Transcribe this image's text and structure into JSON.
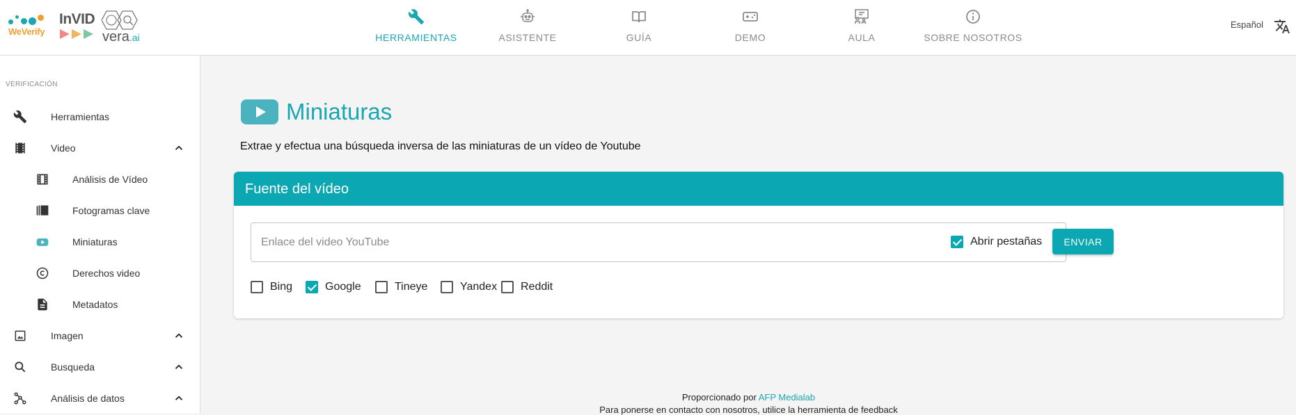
{
  "header": {
    "logos": {
      "weverify": "WeVerify",
      "invid": "InVID",
      "vera": "vera",
      "vera_suffix": ".ai"
    },
    "nav": [
      {
        "label": "HERRAMIENTAS",
        "icon": "wrench-icon",
        "active": true
      },
      {
        "label": "ASISTENTE",
        "icon": "robot-icon",
        "active": false
      },
      {
        "label": "GUÍA",
        "icon": "book-icon",
        "active": false
      },
      {
        "label": "DEMO",
        "icon": "gamepad-icon",
        "active": false
      },
      {
        "label": "AULA",
        "icon": "classroom-icon",
        "active": false
      },
      {
        "label": "SOBRE NOSOTROS",
        "icon": "info-icon",
        "active": false
      }
    ],
    "language": "Español"
  },
  "sidebar": {
    "section": "VERIFICACIÓN",
    "items": [
      {
        "label": "Herramientas",
        "icon": "wrench-icon"
      },
      {
        "label": "Video",
        "icon": "film-icon",
        "expanded": true
      },
      {
        "label": "Análisis de Vídeo",
        "icon": "film-strip-icon",
        "sub": true
      },
      {
        "label": "Fotogramas clave",
        "icon": "frames-icon",
        "sub": true
      },
      {
        "label": "Miniaturas",
        "icon": "youtube-icon",
        "sub": true
      },
      {
        "label": "Derechos video",
        "icon": "copyright-icon",
        "sub": true
      },
      {
        "label": "Metadatos",
        "icon": "document-icon",
        "sub": true
      },
      {
        "label": "Imagen",
        "icon": "image-icon",
        "expanded": true
      },
      {
        "label": "Busqueda",
        "icon": "search-icon",
        "expanded": true
      },
      {
        "label": "Análisis de datos",
        "icon": "graph-icon",
        "expanded": true
      }
    ]
  },
  "main": {
    "title": "Miniaturas",
    "subtitle": "Extrae y efectua una búsqueda inversa de las miniaturas de un vídeo de Youtube",
    "card": {
      "header": "Fuente del vídeo",
      "input_placeholder": "Enlace del video YouTube",
      "input_value": "",
      "open_tabs": {
        "label": "Abrir pestañas",
        "checked": true
      },
      "submit_label": "ENVIAR",
      "engines": [
        {
          "label": "Bing",
          "checked": false
        },
        {
          "label": "Google",
          "checked": true
        },
        {
          "label": "Tineye",
          "checked": false
        },
        {
          "label": "Yandex",
          "checked": false
        },
        {
          "label": "Reddit",
          "checked": false
        }
      ]
    },
    "footer": {
      "powered_by": "Proporcionado por",
      "powered_link": "AFP Medialab",
      "contact": "Para ponerse en contacto con nosotros, utilice la herramienta de feedback"
    }
  },
  "colors": {
    "accent": "#0ba7b3",
    "accent_text": "#1aa6b3"
  }
}
